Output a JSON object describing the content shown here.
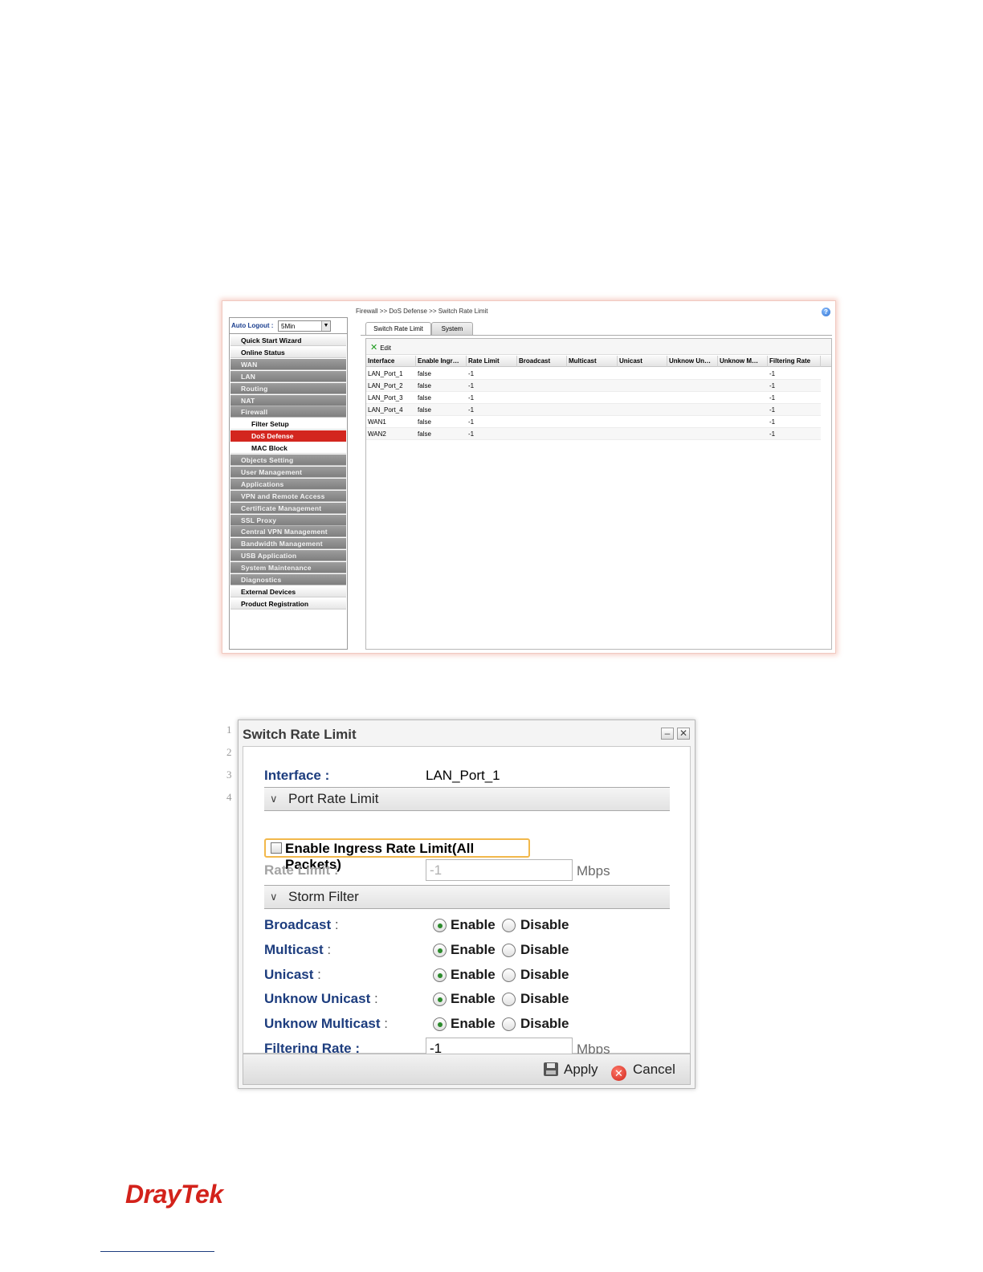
{
  "router_ui": {
    "auto_logout": {
      "label": "Auto Logout :",
      "value": "5Min"
    },
    "menu": [
      {
        "label": "Quick Start Wizard",
        "style": "light"
      },
      {
        "label": "Online Status",
        "style": "light"
      },
      {
        "label": "WAN",
        "style": "gray"
      },
      {
        "label": "LAN",
        "style": "gray"
      },
      {
        "label": "Routing",
        "style": "gray"
      },
      {
        "label": "NAT",
        "style": "gray"
      },
      {
        "label": "Firewall",
        "style": "gray"
      },
      {
        "label": "Filter Setup",
        "style": "sub"
      },
      {
        "label": "DoS Defense",
        "style": "active"
      },
      {
        "label": "MAC Block",
        "style": "sub"
      },
      {
        "label": "Objects Setting",
        "style": "gray"
      },
      {
        "label": "User Management",
        "style": "gray"
      },
      {
        "label": "Applications",
        "style": "gray"
      },
      {
        "label": "VPN and Remote Access",
        "style": "gray"
      },
      {
        "label": "Certificate Management",
        "style": "gray"
      },
      {
        "label": "SSL Proxy",
        "style": "gray"
      },
      {
        "label": "Central VPN Management",
        "style": "gray"
      },
      {
        "label": "Bandwidth Management",
        "style": "gray"
      },
      {
        "label": "USB Application",
        "style": "gray"
      },
      {
        "label": "System Maintenance",
        "style": "gray"
      },
      {
        "label": "Diagnostics",
        "style": "gray"
      },
      {
        "label": "External Devices",
        "style": "light"
      },
      {
        "label": "Product Registration",
        "style": "light"
      }
    ],
    "breadcrumb": "Firewall >> DoS Defense >> Switch Rate Limit",
    "help_icon": "?",
    "tabs": [
      {
        "label": "Switch Rate Limit",
        "active": true
      },
      {
        "label": "System",
        "active": false
      }
    ],
    "toolbar": {
      "edit_label": "Edit",
      "edit_icon": "✕"
    },
    "columns": [
      "Interface",
      "Enable Ingr…",
      "Rate Limit",
      "Broadcast",
      "Multicast",
      "Unicast",
      "Unknow Un…",
      "Unknow M…",
      "Filtering Rate"
    ],
    "rows": [
      [
        "LAN_Port_1",
        "false",
        "-1",
        "",
        "",
        "",
        "",
        "",
        "-1"
      ],
      [
        "LAN_Port_2",
        "false",
        "-1",
        "",
        "",
        "",
        "",
        "",
        "-1"
      ],
      [
        "LAN_Port_3",
        "false",
        "-1",
        "",
        "",
        "",
        "",
        "",
        "-1"
      ],
      [
        "LAN_Port_4",
        "false",
        "-1",
        "",
        "",
        "",
        "",
        "",
        "-1"
      ],
      [
        "WAN1",
        "false",
        "-1",
        "",
        "",
        "",
        "",
        "",
        "-1"
      ],
      [
        "WAN2",
        "false",
        "-1",
        "",
        "",
        "",
        "",
        "",
        "-1"
      ]
    ]
  },
  "dialog": {
    "gutter": [
      "1",
      "2",
      "3",
      "4"
    ],
    "title": "Switch Rate Limit",
    "minimize_icon": "–",
    "close_icon": "✕",
    "interface": {
      "label": "Interface :",
      "value": "LAN_Port_1"
    },
    "port_section": "Port Rate Limit",
    "ingress": {
      "label": "Enable Ingress Rate Limit(All Packets)",
      "checked": false
    },
    "rate_limit": {
      "label": "Rate Limit :",
      "value": "-1",
      "unit": "Mbps"
    },
    "storm_section": "Storm Filter",
    "chevron": "∨",
    "enable_label": "Enable",
    "disable_label": "Disable",
    "filters": [
      {
        "label": "Broadcast",
        "colon": ":",
        "value": "Enable"
      },
      {
        "label": "Multicast",
        "colon": ":",
        "value": "Enable"
      },
      {
        "label": "Unicast",
        "colon": ":",
        "value": "Enable"
      },
      {
        "label": "Unknow Unicast",
        "colon": ":",
        "value": "Enable"
      },
      {
        "label": "Unknow Multicast",
        "colon": ":",
        "value": "Enable"
      }
    ],
    "filtering_rate": {
      "label": "Filtering Rate :",
      "value": "-1",
      "unit": "Mbps"
    },
    "apply_label": "Apply",
    "cancel_label": "Cancel",
    "cancel_icon": "✕"
  },
  "footer": {
    "brand": "DrayTek"
  },
  "colors": {
    "brand_red": "#d3221b",
    "label_blue": "#1d3d7e",
    "active_menu": "#d3261f"
  }
}
